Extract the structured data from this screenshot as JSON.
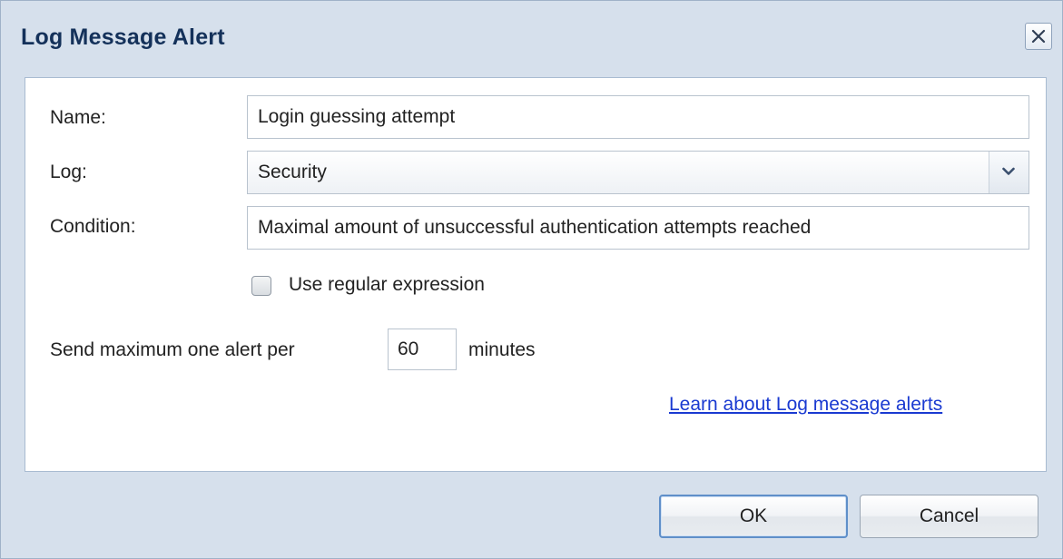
{
  "dialog": {
    "title": "Log Message Alert",
    "close_icon": "close-icon"
  },
  "form": {
    "name_label": "Name:",
    "name_value": "Login guessing attempt",
    "log_label": "Log:",
    "log_value": "Security",
    "condition_label": "Condition:",
    "condition_value": "Maximal amount of unsuccessful authentication attempts reached",
    "regex_label": "Use regular expression",
    "regex_checked": false,
    "send_prefix": "Send maximum one alert per",
    "interval_value": "60",
    "send_suffix": "minutes",
    "learn_link": "Learn about Log message alerts"
  },
  "buttons": {
    "ok_label": "OK",
    "cancel_label": "Cancel"
  },
  "colors": {
    "dialog_bg": "#d6e0ec",
    "title_text": "#14315a",
    "link": "#1a3ad1"
  }
}
